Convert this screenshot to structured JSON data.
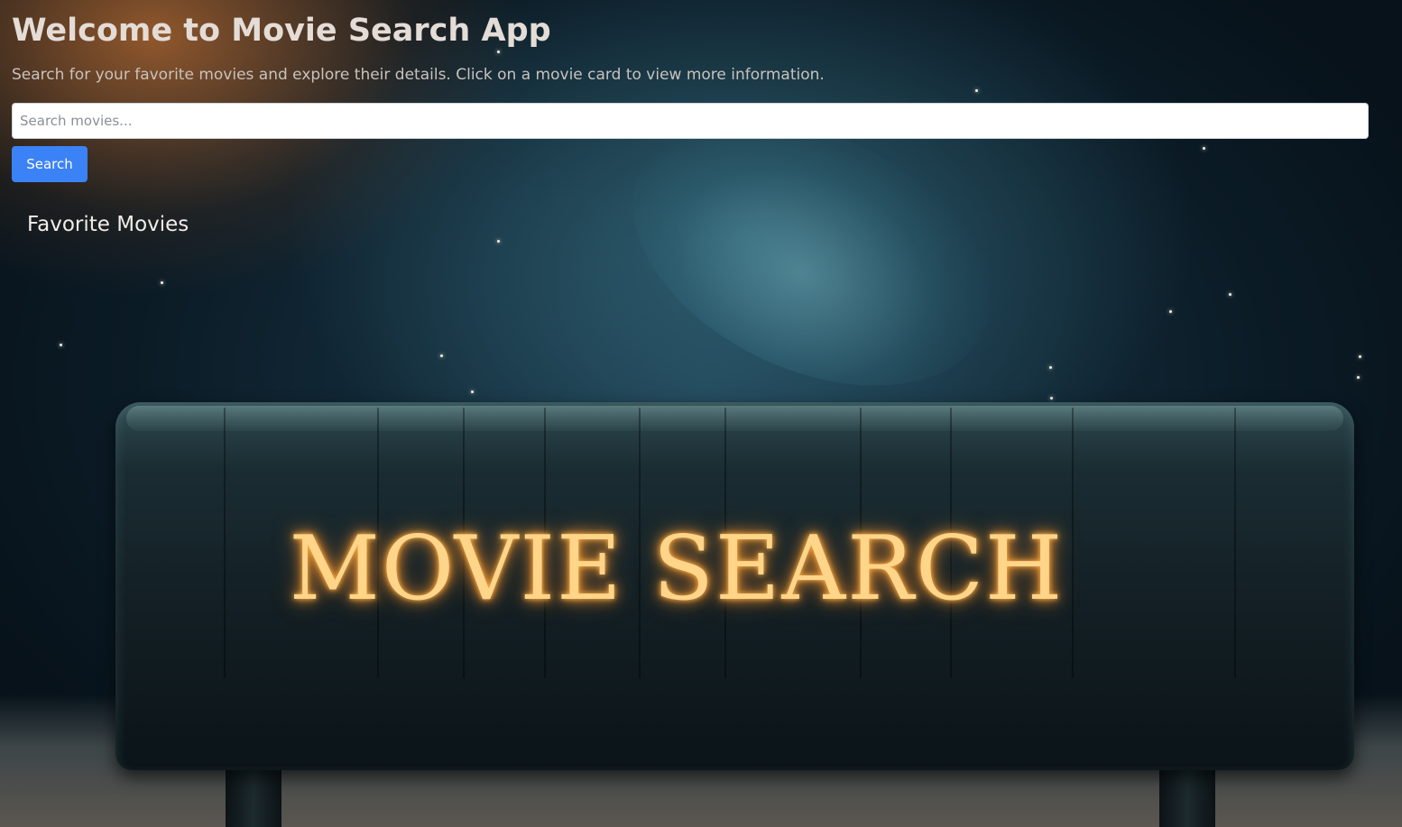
{
  "header": {
    "title": "Welcome to Movie Search App",
    "subtitle": "Search for your favorite movies and explore their details. Click on a movie card to view more information."
  },
  "search": {
    "placeholder": "Search movies...",
    "value": "",
    "button_label": "Search",
    "button_color": "#3b82f6"
  },
  "favorites": {
    "heading": "Favorite Movies",
    "items": []
  },
  "background": {
    "logo_text": "MOVIE SEARCH"
  }
}
